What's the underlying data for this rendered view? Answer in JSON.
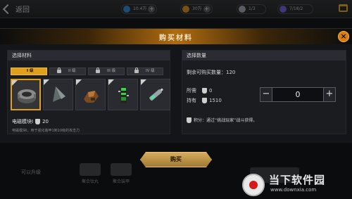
{
  "topbar": {
    "back_label": "返回",
    "resources": [
      {
        "value": "10.4万",
        "icon": "gem-icon",
        "color": "#2f7fc4"
      },
      {
        "value": "30万",
        "icon": "gold-icon",
        "color": "#d08a1a"
      },
      {
        "value": "1/3",
        "icon": "medal-icon",
        "color": "#9aa0a6"
      },
      {
        "value": "7/18/2",
        "icon": "token-icon",
        "color": "#6a5acd"
      }
    ]
  },
  "dialog": {
    "title": "购买材料",
    "left_panel": {
      "header": "选择材料",
      "tabs": [
        {
          "label": "I 级",
          "active": true,
          "locked": true
        },
        {
          "label": "II 级",
          "active": false,
          "locked": true
        },
        {
          "label": "III 级",
          "active": false,
          "locked": true
        },
        {
          "label": "IV 级",
          "active": false,
          "locked": true
        }
      ],
      "items": [
        {
          "icon": "magnetic-module-icon",
          "selected": true
        },
        {
          "icon": "pyramid-crystal-icon",
          "selected": false
        },
        {
          "icon": "ore-chunk-icon",
          "selected": false
        },
        {
          "icon": "circuit-board-icon",
          "selected": false
        },
        {
          "icon": "battery-cell-icon",
          "selected": false
        }
      ],
      "selected_name": "电磁模块I",
      "selected_price": "20",
      "description": "电磁模块I，用于强化装甲1到10级的攻击力"
    },
    "right_panel": {
      "header": "选择数量",
      "remaining_label": "剩余可购买数量：120",
      "required_label": "所需",
      "required_value": "0",
      "owned_label": "持有",
      "owned_value": "1510",
      "quantity": "0",
      "minus_label": "−",
      "plus_label": "+",
      "hint": "积分：通过“挑战玩家”战斗获得。"
    },
    "buy_label": "购买"
  },
  "background": {
    "upgrade_label": "可以升级",
    "items": [
      "聚合钛丸",
      "聚合装甲"
    ]
  },
  "watermark": {
    "title": "当下软件园",
    "url": "www.downxia.com"
  },
  "colors": {
    "accent": "#e0a01c",
    "header_glow": "#b06c10",
    "close": "#d77d10"
  }
}
